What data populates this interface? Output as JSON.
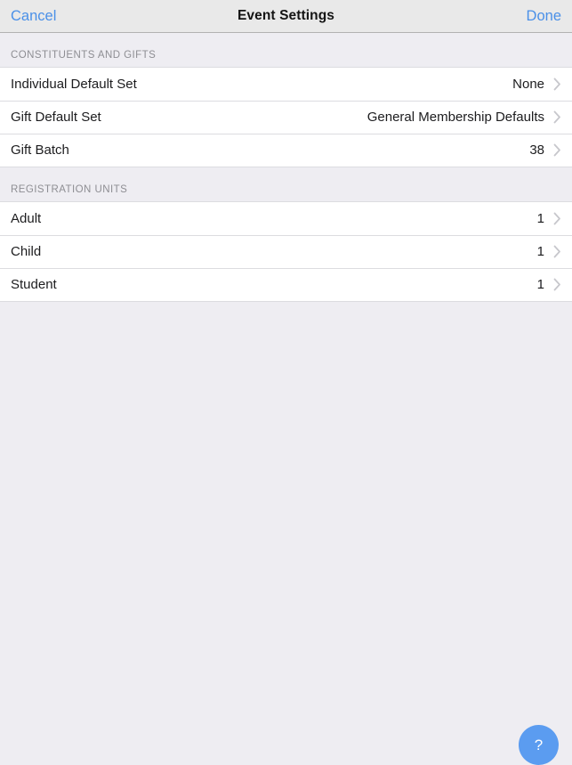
{
  "navbar": {
    "cancel_label": "Cancel",
    "title": "Event Settings",
    "done_label": "Done",
    "link_color": "#4a90e8",
    "title_color": "#141414",
    "background": "#e9e9e9"
  },
  "page": {
    "background_color": "#eeedf2",
    "row_background": "#ffffff",
    "separator_color": "#dcdce0",
    "section_header_color": "#8e8e93",
    "chevron_color": "#c7c7cc"
  },
  "sections": [
    {
      "header": "CONSTITUENTS AND GIFTS",
      "rows": [
        {
          "label": "Individual Default Set",
          "value": "None",
          "accessory": "chevron-right-icon"
        },
        {
          "label": "Gift Default Set",
          "value": "General Membership Defaults",
          "accessory": "chevron-right-icon"
        },
        {
          "label": "Gift Batch",
          "value": "38",
          "accessory": "chevron-right-icon"
        }
      ]
    },
    {
      "header": "REGISTRATION UNITS",
      "rows": [
        {
          "label": "Adult",
          "value": "1",
          "accessory": "chevron-right-icon"
        },
        {
          "label": "Child",
          "value": "1",
          "accessory": "chevron-right-icon"
        },
        {
          "label": "Student",
          "value": "1",
          "accessory": "chevron-right-icon"
        }
      ]
    }
  ],
  "help_button": {
    "glyph": "?",
    "icon_name": "question-mark-icon",
    "background_color": "#5b9cf0"
  }
}
